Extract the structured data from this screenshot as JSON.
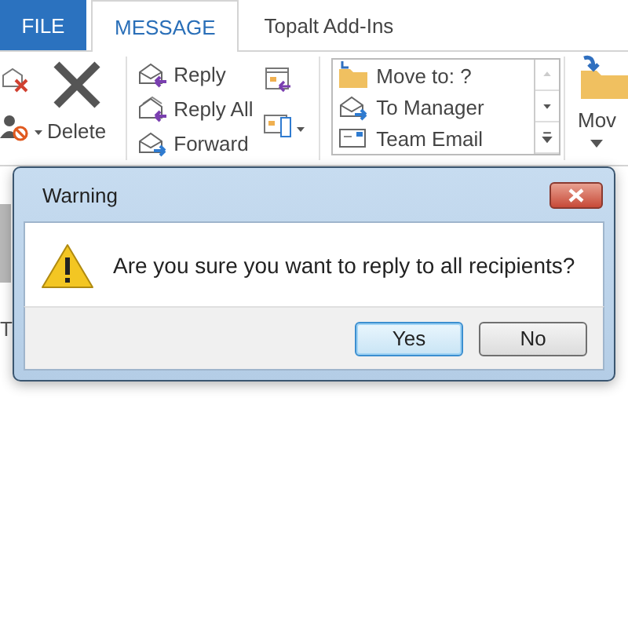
{
  "tabs": [
    {
      "label": "FILE",
      "kind": "file",
      "selected": false
    },
    {
      "label": "MESSAGE",
      "kind": "tab",
      "selected": true
    },
    {
      "label": "Topalt Add-Ins",
      "kind": "tab",
      "selected": false
    }
  ],
  "ribbon": {
    "delete_group": {
      "label": "Delete"
    },
    "respond_group": {
      "items": [
        {
          "label": "Reply",
          "kind": "reply"
        },
        {
          "label": "Reply All",
          "kind": "replyall"
        },
        {
          "label": "Forward",
          "kind": "forward"
        }
      ]
    },
    "quick_steps": {
      "items": [
        {
          "label": "Move to: ?",
          "kind": "folder"
        },
        {
          "label": "To Manager",
          "kind": "forward"
        },
        {
          "label": "Team Email",
          "kind": "mail"
        }
      ]
    },
    "move_group": {
      "label": "Mov"
    }
  },
  "background_text": "T",
  "dialog": {
    "title": "Warning",
    "message": "Are you sure you want to reply to all recipients?",
    "buttons": [
      {
        "label": "Yes",
        "default": true
      },
      {
        "label": "No",
        "default": false
      }
    ]
  }
}
